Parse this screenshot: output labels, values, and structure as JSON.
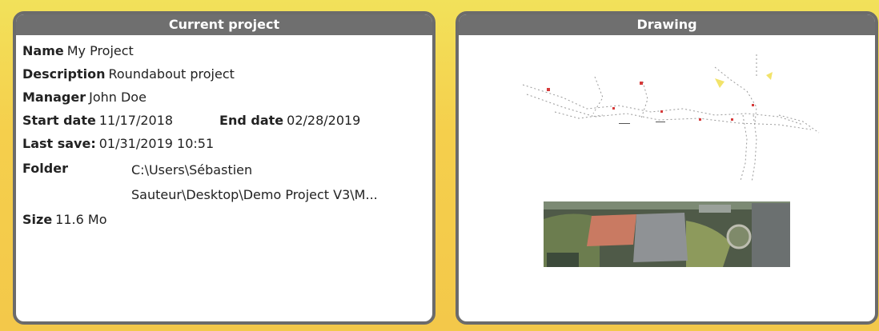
{
  "current_project": {
    "title": "Current project",
    "name_label": "Name",
    "name_value": "My Project",
    "description_label": "Description",
    "description_value": "Roundabout project",
    "manager_label": "Manager",
    "manager_value": "John Doe",
    "start_label": "Start date",
    "start_value": "11/17/2018",
    "end_label": "End date",
    "end_value": "02/28/2019",
    "last_save_label": "Last save:",
    "last_save_value": "01/31/2019 10:51",
    "folder_label": "Folder",
    "folder_line1": "C:\\Users\\Sébastien",
    "folder_line2": "Sauteur\\Desktop\\Demo Project V3\\M...",
    "size_label": "Size",
    "size_value": "11.6 Mo"
  },
  "drawing": {
    "title": "Drawing"
  },
  "colors": {
    "background": "#f3d14e",
    "panel_border": "#6b6b6b",
    "header_bg": "#6f6f6f"
  }
}
